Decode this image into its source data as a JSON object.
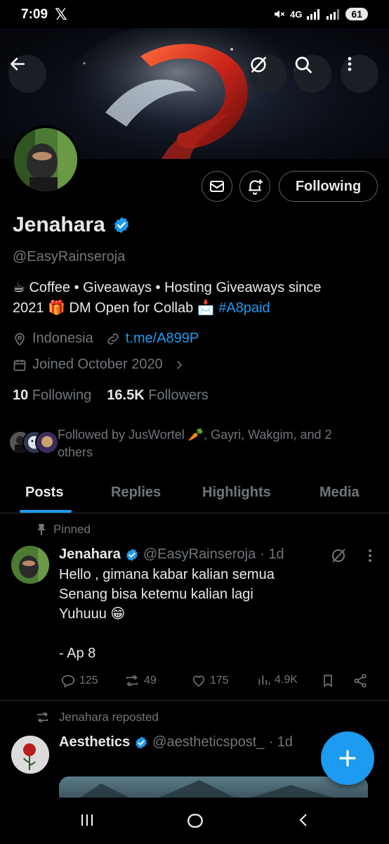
{
  "status_bar": {
    "time": "7:09",
    "x_logo": "𝕏",
    "network": "4G",
    "battery": "61"
  },
  "header": {
    "back_icon": "arrow-left-icon",
    "grok_icon": "grok-icon",
    "search_icon": "search-icon",
    "more_icon": "more-vertical-icon"
  },
  "profile": {
    "name": "Jenahara",
    "verified": true,
    "handle": "@EasyRainseroja",
    "bio_line1": "☕ Coffee • Giveaways • Hosting Giveaways since",
    "bio_line2_text": "2021 🎁 DM Open for Collab 📩 ",
    "bio_hashtag": "#A8paid",
    "location": "Indonesia",
    "link": "t.me/A899P",
    "joined": "Joined October 2020",
    "following_count": "10",
    "following_label": "Following",
    "followers_count": "16.5K",
    "followers_label": "Followers",
    "followed_by": "Followed by JusWortel 🥕, Gayri, Wakgim, and 2 others",
    "following_button": "Following"
  },
  "tabs": [
    {
      "label": "Posts",
      "active": true
    },
    {
      "label": "Replies",
      "active": false
    },
    {
      "label": "Highlights",
      "active": false
    },
    {
      "label": "Media",
      "active": false
    }
  ],
  "pinned_post": {
    "pinned_label": "Pinned",
    "author": "Jenahara",
    "handle": "@EasyRainseroja",
    "time": "· 1d",
    "lines": [
      "Hello , gimana kabar kalian semua",
      "Senang bisa ketemu kalian lagi",
      "Yuhuuu 😁",
      "",
      "- Ap 8"
    ],
    "replies": "125",
    "reposts": "49",
    "likes": "175",
    "views": "4.9K"
  },
  "repost": {
    "reposted_label": "Jenahara reposted",
    "author": "Aesthetics",
    "handle": "@aestheticspost_",
    "time": "· 1d"
  },
  "fab_icon": "plus-icon",
  "colors": {
    "accent": "#1d9bf0",
    "muted": "#71767b",
    "text": "#e7e9ea",
    "border": "#2f3336"
  }
}
